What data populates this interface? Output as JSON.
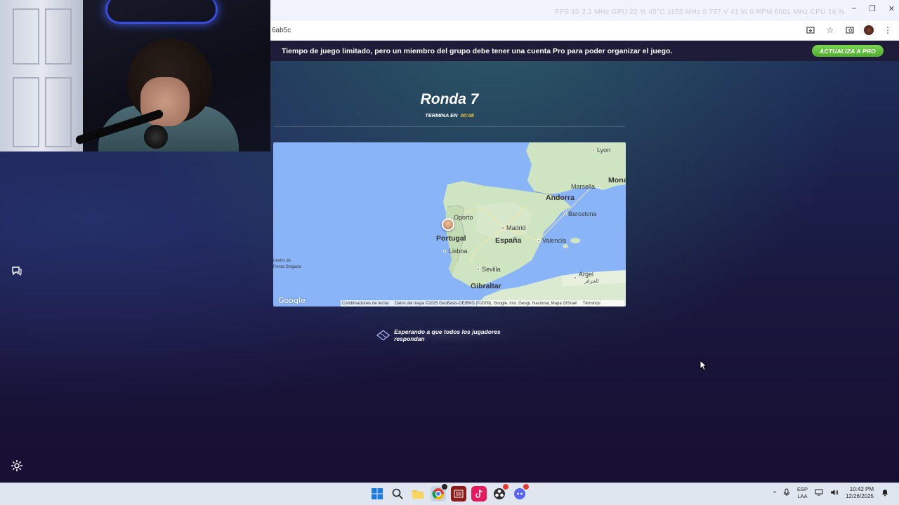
{
  "browser": {
    "url": "6ab5c",
    "osd_text": "FPS  10   2.1 MHz   GPU  22 %  45°C  1155 MHz  0.737 V  41 W  0 RPM  6001 MHz    CPU  16 %",
    "window_controls": [
      "–",
      "❐",
      "✕"
    ]
  },
  "promo": {
    "message": "Tiempo de juego limitado, pero un miembro del grupo debe tener una cuenta Pro para poder organizar el juego.",
    "button_label": "ACTUALIZA A PRO"
  },
  "round": {
    "title": "Ronda 7",
    "ends_label": "TERMINA EN",
    "time_left": "00:48"
  },
  "map": {
    "labels": {
      "lyon": "Lyon",
      "marsella": "Marsella",
      "monaco": "Mona",
      "andorra": "Andorra",
      "barcelona": "Barcelona",
      "oporto": "Oporto",
      "madrid": "Madrid",
      "portugal": "Portugal",
      "espana": "España",
      "valencia": "Valencia",
      "lisboa": "Lisboa",
      "sevilla": "Sevilla",
      "argel": "Argel",
      "argel_ar": "الجزائر",
      "gibraltar": "Gibraltar",
      "azores": "Ponta Delgada",
      "azores_top": "uestro de"
    },
    "google": "Google",
    "footer": {
      "shortcuts": "Combinaciones de teclas",
      "attribution": "Datos del mapa ©2025 GeoBasis-DE/BKG (©2009), Google, Inst. Geogr. Nacional, Mapa GISrael",
      "terms": "Términos"
    }
  },
  "waiting": {
    "text": "Esperando a que todos los jugadores respondan"
  },
  "taskbar": {
    "lang_top": "ESP",
    "lang_bottom": "LAA",
    "time": "10:42 PM",
    "date": "12/26/2025"
  }
}
